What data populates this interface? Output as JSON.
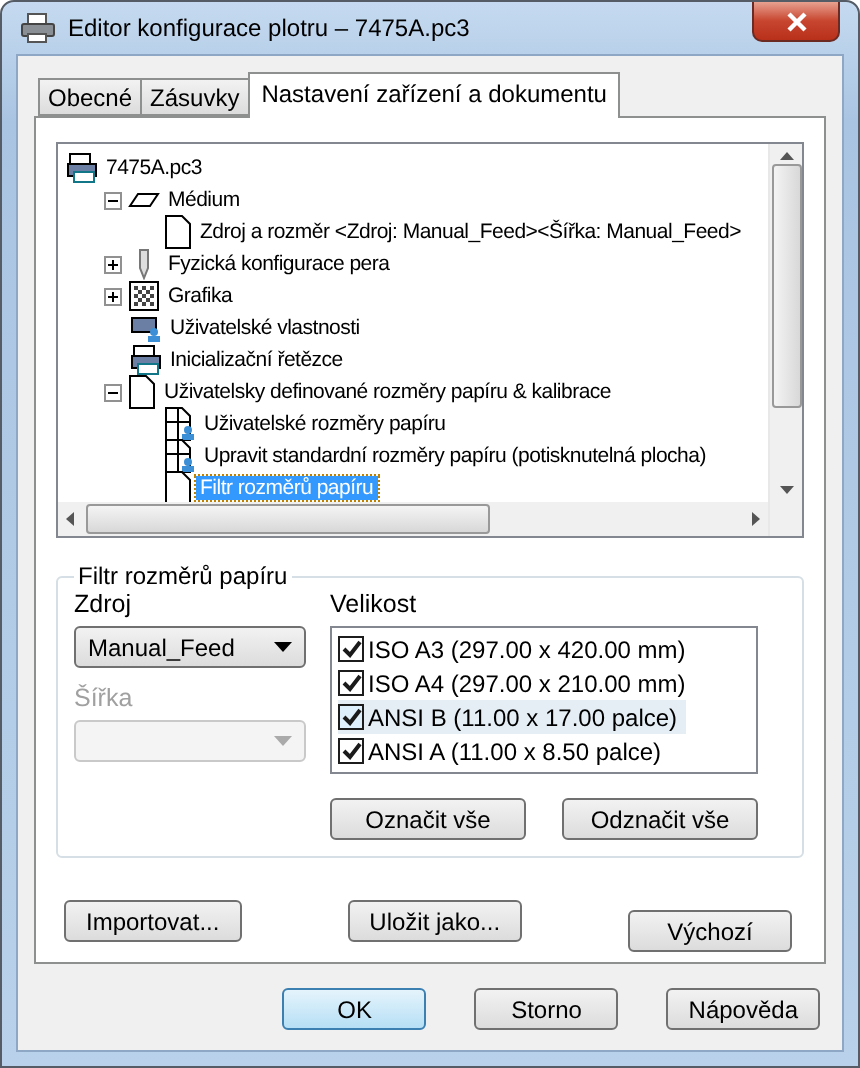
{
  "window": {
    "title": "Editor konfigurace plotru – 7475A.pc3"
  },
  "tabs": [
    {
      "label": "Obecné",
      "selected": false
    },
    {
      "label": "Zásuvky",
      "selected": false
    },
    {
      "label": "Nastavení zařízení a dokumentu",
      "selected": true
    }
  ],
  "tree": {
    "label": "7475A.pc3",
    "kind": "plotter",
    "selected": false,
    "children": [
      {
        "label": "Médium",
        "kind": "medium",
        "expanded": true,
        "selected": false,
        "children": [
          {
            "label": "Zdroj a rozměr <Zdroj: Manual_Feed><Šířka: Manual_Feed>",
            "kind": "page",
            "selected": false
          }
        ]
      },
      {
        "label": "Fyzická konfigurace pera",
        "kind": "pen",
        "expanded": false,
        "selected": false
      },
      {
        "label": "Grafika",
        "kind": "pattern",
        "expanded": false,
        "selected": false
      },
      {
        "label": "Uživatelské vlastnosti",
        "kind": "user-plotter",
        "selected": false
      },
      {
        "label": "Inicializační řetězce",
        "kind": "plotter",
        "selected": false
      },
      {
        "label": "Uživatelsky definované rozměry papíru & kalibrace",
        "kind": "page",
        "expanded": true,
        "selected": false,
        "children": [
          {
            "label": "Uživatelské rozměry papíru",
            "kind": "user-page",
            "selected": false
          },
          {
            "label": "Upravit standardní rozměry papíru (potisknutelná plocha)",
            "kind": "user-page",
            "selected": false
          },
          {
            "label": "Filtr rozměrů papíru",
            "kind": "page",
            "selected": true
          }
        ]
      }
    ]
  },
  "filter": {
    "title": "Filtr rozměrů papíru",
    "source": {
      "label": "Zdroj",
      "value": "Manual_Feed",
      "disabled": false
    },
    "width": {
      "label": "Šířka",
      "disabled": true
    },
    "size": {
      "label": "Velikost",
      "items": [
        {
          "label": "ISO A3 (297.00 x 420.00 mm)",
          "checked": true,
          "selected": false
        },
        {
          "label": "ISO A4 (297.00 x 210.00 mm)",
          "checked": true,
          "selected": false
        },
        {
          "label": "ANSI B (11.00 x 17.00 palce)",
          "checked": true,
          "selected": true
        },
        {
          "label": "ANSI A (11.00 x 8.50 palce)",
          "checked": true,
          "selected": false
        }
      ]
    },
    "buttons": [
      "Označit vše",
      "Odznačit vše"
    ]
  },
  "panel_buttons": [
    "Importovat...",
    "Uložit jako...",
    "Výchozí"
  ],
  "dialog_buttons": [
    {
      "label": "OK",
      "default": true
    },
    {
      "label": "Storno",
      "default": false
    },
    {
      "label": "Nápověda",
      "default": false
    }
  ]
}
